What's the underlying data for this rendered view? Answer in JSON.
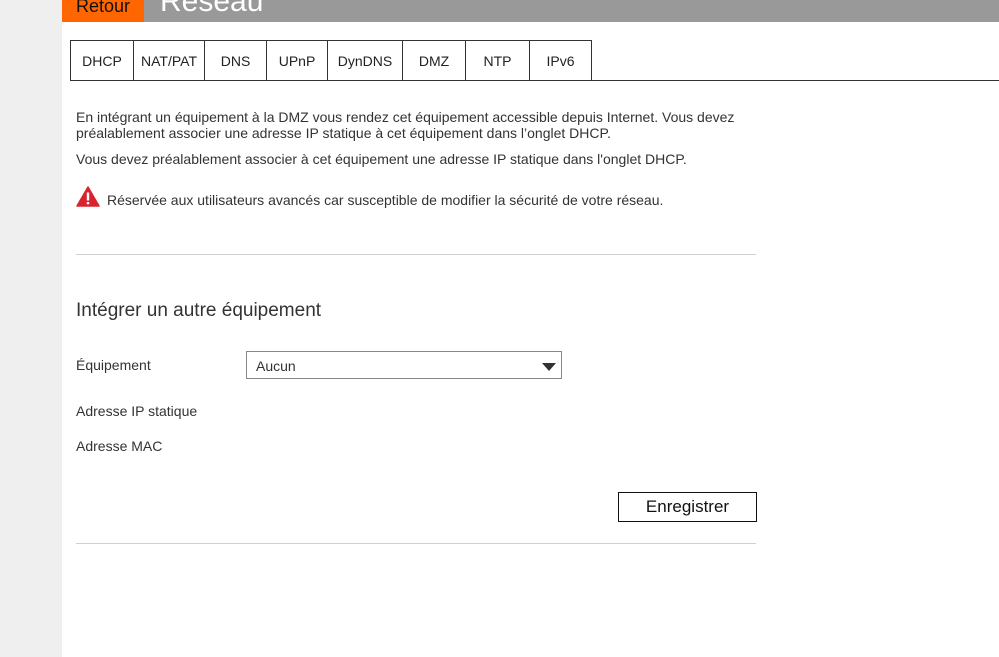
{
  "header": {
    "back_label": "Retour",
    "title": "Réseau",
    "accent_color": "#ff6600",
    "bar_color": "#999999"
  },
  "tabs": [
    {
      "label": "DHCP",
      "active": false
    },
    {
      "label": "NAT/PAT",
      "active": false
    },
    {
      "label": "DNS",
      "active": false
    },
    {
      "label": "UPnP",
      "active": false
    },
    {
      "label": "DynDNS",
      "active": false
    },
    {
      "label": "DMZ",
      "active": true
    },
    {
      "label": "NTP",
      "active": false
    },
    {
      "label": "IPv6",
      "active": false
    }
  ],
  "intro": {
    "line1": "En intégrant un équipement à la DMZ vous rendez cet équipement accessible depuis Internet. Vous devez",
    "line2": "préalablement associer une adresse IP statique à cet équipement dans l’onglet DHCP.",
    "line3": "Vous devez préalablement associer à cet équipement une adresse IP statique dans l'onglet DHCP."
  },
  "warning": {
    "icon": "warning-icon",
    "color": "#d9232e",
    "text": "Réservée aux utilisateurs avancés car susceptible de modifier la sécurité de votre réseau."
  },
  "form": {
    "section_title": "Intégrer un autre équipement",
    "device_label": "Équipement",
    "device_selected": "Aucun",
    "ip_label": "Adresse IP statique",
    "mac_label": "Adresse MAC",
    "save_label": "Enregistrer"
  }
}
